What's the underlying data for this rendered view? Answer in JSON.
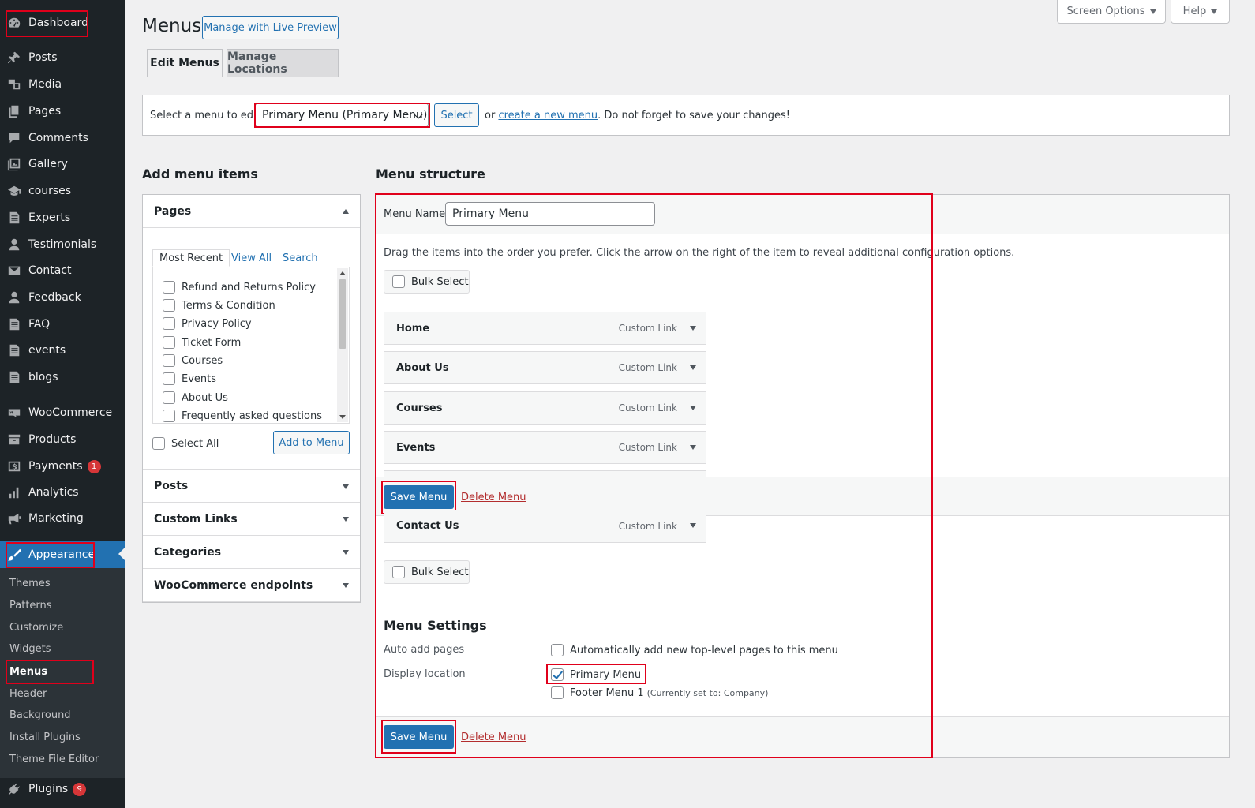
{
  "sidebar": {
    "items": [
      {
        "label": "Dashboard",
        "icon": "dashboard-icon"
      },
      {
        "label": "Posts",
        "icon": "pushpin-icon"
      },
      {
        "label": "Media",
        "icon": "media-icon"
      },
      {
        "label": "Pages",
        "icon": "pages-icon"
      },
      {
        "label": "Comments",
        "icon": "comment-icon"
      },
      {
        "label": "Gallery",
        "icon": "gallery-icon"
      },
      {
        "label": "courses",
        "icon": "graduation-cap-icon"
      },
      {
        "label": "Experts",
        "icon": "document-icon"
      },
      {
        "label": "Testimonials",
        "icon": "user-icon"
      },
      {
        "label": "Contact",
        "icon": "mail-icon"
      },
      {
        "label": "Feedback",
        "icon": "user-icon"
      },
      {
        "label": "FAQ",
        "icon": "document-icon"
      },
      {
        "label": "events",
        "icon": "document-icon"
      },
      {
        "label": "blogs",
        "icon": "document-icon"
      },
      {
        "label": "WooCommerce",
        "icon": "woo-icon"
      },
      {
        "label": "Products",
        "icon": "archive-icon"
      },
      {
        "label": "Payments",
        "icon": "dollar-icon",
        "badge": "1"
      },
      {
        "label": "Analytics",
        "icon": "chart-icon"
      },
      {
        "label": "Marketing",
        "icon": "megaphone-icon"
      },
      {
        "label": "Appearance",
        "icon": "paintbrush-icon"
      },
      {
        "label": "Plugins",
        "icon": "plugin-icon",
        "badge": "9"
      }
    ],
    "submenu": [
      "Themes",
      "Patterns",
      "Customize",
      "Widgets",
      "Menus",
      "Header",
      "Background",
      "Install Plugins",
      "Theme File Editor"
    ]
  },
  "top": {
    "screen_options": "Screen Options",
    "help": "Help"
  },
  "header": {
    "title": "Menus",
    "live_preview": "Manage with Live Preview"
  },
  "tabs": [
    "Edit Menus",
    "Manage Locations"
  ],
  "select_bar": {
    "label": "Select a menu to edit:",
    "selected": "Primary Menu (Primary Menu)",
    "button": "Select",
    "or": "or",
    "create_link": "create a new menu",
    "suffix": ". Do not forget to save your changes!"
  },
  "add_items": {
    "heading": "Add menu items",
    "pages_heading": "Pages",
    "page_tabs": [
      "Most Recent",
      "View All",
      "Search"
    ],
    "pages": [
      "Refund and Returns Policy",
      "Terms & Condition",
      "Privacy Policy",
      "Ticket Form",
      "Courses",
      "Events",
      "About Us",
      "Frequently asked questions"
    ],
    "select_all": "Select All",
    "add_button": "Add to Menu",
    "sections": [
      "Posts",
      "Custom Links",
      "Categories",
      "WooCommerce endpoints"
    ]
  },
  "structure": {
    "heading": "Menu structure",
    "menu_name_label": "Menu Name",
    "menu_name_value": "Primary Menu",
    "instructions": "Drag the items into the order you prefer. Click the arrow on the right of the item to reveal additional configuration options.",
    "bulk_select": "Bulk Select",
    "items": [
      {
        "title": "Home",
        "type": "Custom Link"
      },
      {
        "title": "About Us",
        "type": "Custom Link"
      },
      {
        "title": "Courses",
        "type": "Custom Link"
      },
      {
        "title": "Events",
        "type": "Custom Link"
      },
      {
        "title": "Contact Us",
        "type": "Custom Link"
      }
    ],
    "save": "Save Menu",
    "delete": "Delete Menu"
  },
  "settings": {
    "heading": "Menu Settings",
    "auto_add_label": "Auto add pages",
    "auto_add_option": "Automatically add new top-level pages to this menu",
    "display_label": "Display location",
    "primary_option": "Primary Menu",
    "footer_option": "Footer Menu 1",
    "footer_note": "(Currently set to: Company)"
  },
  "colors": {
    "accent": "#2271b1",
    "sidebar": "#1d2327",
    "highlight_box": "#e0001b",
    "delete": "#b32d2e"
  }
}
